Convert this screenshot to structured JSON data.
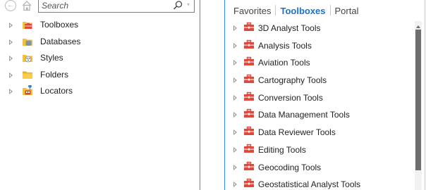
{
  "catalog": {
    "nav": {
      "back_icon": "back-arrow-icon",
      "home_icon": "home-icon"
    },
    "search": {
      "placeholder": "Search",
      "value": "",
      "icon": "search-icon"
    },
    "items": [
      {
        "label": "Toolboxes",
        "icon": "toolbox-folder-icon"
      },
      {
        "label": "Databases",
        "icon": "database-folder-icon"
      },
      {
        "label": "Styles",
        "icon": "styles-folder-icon"
      },
      {
        "label": "Folders",
        "icon": "folder-icon"
      },
      {
        "label": "Locators",
        "icon": "locator-folder-icon"
      }
    ]
  },
  "geoprocessing": {
    "tabs": [
      {
        "label": "Favorites",
        "active": false
      },
      {
        "label": "Toolboxes",
        "active": true
      },
      {
        "label": "Portal",
        "active": false
      }
    ],
    "toolboxes": [
      {
        "label": "3D Analyst Tools",
        "icon": "toolbox-icon"
      },
      {
        "label": "Analysis Tools",
        "icon": "toolbox-icon"
      },
      {
        "label": "Aviation Tools",
        "icon": "toolbox-icon"
      },
      {
        "label": "Cartography Tools",
        "icon": "toolbox-icon"
      },
      {
        "label": "Conversion Tools",
        "icon": "toolbox-icon"
      },
      {
        "label": "Data Management Tools",
        "icon": "toolbox-icon"
      },
      {
        "label": "Data Reviewer Tools",
        "icon": "toolbox-icon"
      },
      {
        "label": "Editing Tools",
        "icon": "toolbox-icon"
      },
      {
        "label": "Geocoding Tools",
        "icon": "toolbox-icon"
      },
      {
        "label": "Geostatistical Analyst Tools",
        "icon": "toolbox-icon"
      }
    ]
  },
  "colors": {
    "accent": "#1a73c7",
    "pane_border": "#3b8ed4",
    "toolbox_red": "#e0483c",
    "folder_yellow": "#f2c23a",
    "scroll_thumb": "#6e6e6e"
  }
}
